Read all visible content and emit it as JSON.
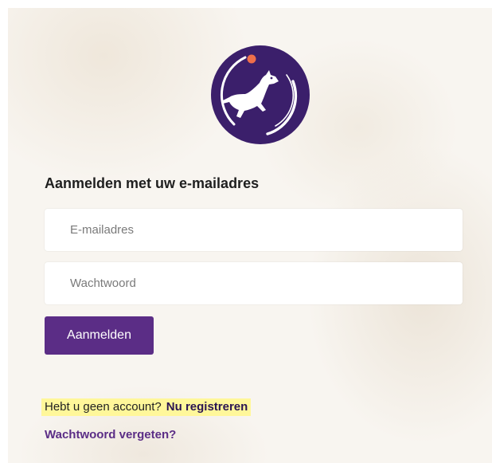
{
  "logo": {
    "icon": "jumping-dog-logo-icon",
    "colors": {
      "circle": "#3b1f6b",
      "ball": "#ef6f4a",
      "figure": "#ffffff"
    }
  },
  "login": {
    "heading": "Aanmelden met uw e-mailadres",
    "email_placeholder": "E-mailadres",
    "password_placeholder": "Wachtwoord",
    "submit_label": "Aanmelden"
  },
  "footer": {
    "no_account_text": "Hebt u geen account?",
    "register_link": "Nu registreren",
    "forgot_password_link": "Wachtwoord vergeten?"
  },
  "colors": {
    "accent": "#5b2d86",
    "highlight": "#fff79a"
  }
}
